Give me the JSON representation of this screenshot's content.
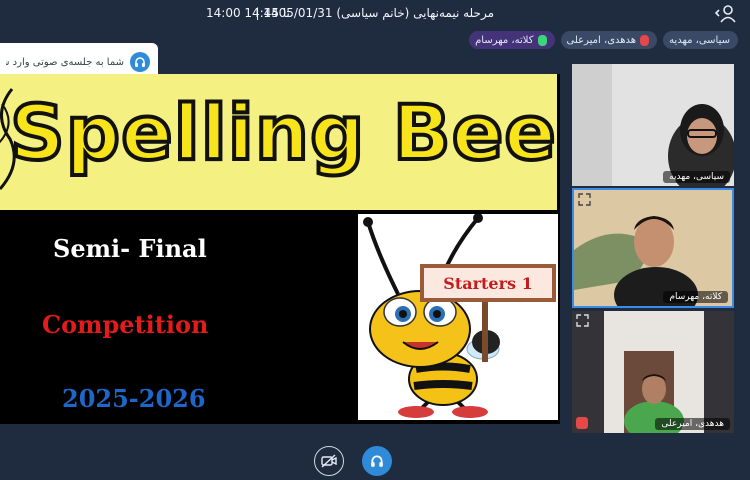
{
  "header": {
    "title": "مرحله نیمه‌نهایی (خانم سیاسی) 1405/01/31 |",
    "time_range": "14:00 تا 14:45"
  },
  "speakers": [
    {
      "label": "سیاسی، مهدیه",
      "mic": "none"
    },
    {
      "label": "هدهدی، امیرعلی",
      "mic": "muted"
    },
    {
      "label": "کلاته، مهرسام",
      "mic": "active"
    }
  ],
  "audio_toast": {
    "message": "شما به جلسه‌ی صوتی وارد شدید",
    "icon": "headphones-icon"
  },
  "slide": {
    "banner_text": "Spelling Bee",
    "line1": "Semi- Final",
    "line2": "Competition",
    "line3": "2025-2026",
    "sign_text": "Starters 1",
    "colors": {
      "banner_bg": "#f4f081",
      "banner_text": "#f8e41a",
      "line2": "#e31b1b",
      "line3": "#1e66c7"
    }
  },
  "participants": [
    {
      "name": "سیاسی، مهدیه"
    },
    {
      "name": "کلاته، مهرسام"
    },
    {
      "name": "هدهدی، امیرعلی"
    }
  ],
  "controls": {
    "camera_icon": "camera-off-icon",
    "audio_icon": "headphones-icon",
    "accent": "#2f8bd8"
  }
}
